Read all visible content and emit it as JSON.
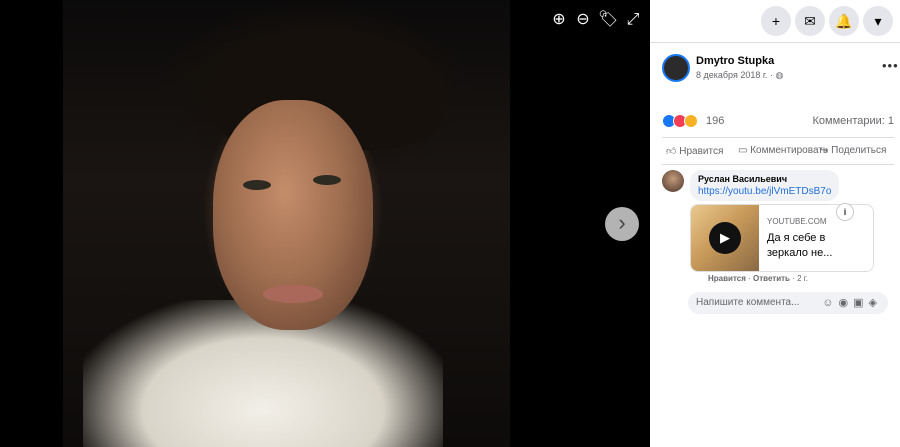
{
  "viewer": {
    "tools": {
      "zoom_in": "⊕",
      "zoom_out": "⊖",
      "tag": "🏷",
      "fullscreen": "⤢"
    },
    "next": "›"
  },
  "topbar": {
    "create": "+",
    "messenger": "✉",
    "notifications": "🔔",
    "account": "▾"
  },
  "post": {
    "author": "Dmytro Stupka",
    "date": "8 декабря 2018 г. · ",
    "privacy_icon": "globe-icon",
    "more": "•••",
    "reactions_count": "196",
    "comments_count": "Комментарии: 1",
    "colors": {
      "like": "#1877f2",
      "love": "#f33e58",
      "wow": "#f7b125"
    }
  },
  "actions": {
    "like": "Нравится",
    "comment": "Комментировать",
    "share": "Поделиться"
  },
  "comment": {
    "author": "Руслан Васильевич",
    "link": "https://youtu.be/jlVmETDsB7o",
    "preview": {
      "domain": "YOUTUBE.COM",
      "title": "Да я себе в зеркало не..."
    },
    "meta": {
      "like": "Нравится",
      "reply": "Ответить",
      "time": "2 г."
    }
  },
  "composer": {
    "placeholder": "Напишите коммента..."
  }
}
